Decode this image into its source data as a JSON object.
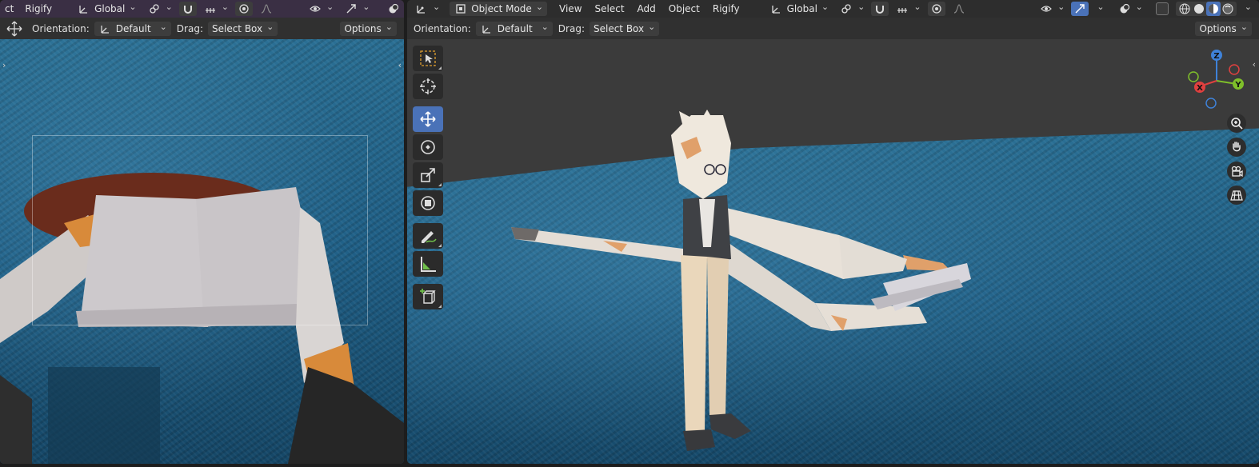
{
  "left_editor": {
    "header": {
      "truncated_menu": "ct",
      "menu_rigify": "Rigify",
      "transform_orientation": "Global"
    },
    "tool_settings": {
      "orientation_label": "Orientation:",
      "orientation_value": "Default",
      "drag_label": "Drag:",
      "drag_value": "Select Box",
      "options_label": "Options"
    }
  },
  "right_editor": {
    "header": {
      "mode": "Object Mode",
      "menus": [
        "View",
        "Select",
        "Add",
        "Object",
        "Rigify"
      ],
      "transform_orientation": "Global"
    },
    "tool_settings": {
      "orientation_label": "Orientation:",
      "orientation_value": "Default",
      "drag_label": "Drag:",
      "drag_value": "Select Box",
      "options_label": "Options"
    },
    "toolbar": [
      "select-box-tool",
      "cursor-tool",
      "move-tool",
      "rotate-tool",
      "scale-tool",
      "transform-tool",
      "annotate-tool",
      "measure-tool",
      "add-cube-tool"
    ],
    "gizmo": {
      "x": "X",
      "y": "Y",
      "z": "Z"
    }
  },
  "colors": {
    "accent": "#4a72b8",
    "axis_x": "#e0403f",
    "axis_y": "#7fbf2a",
    "axis_z": "#3f82d8"
  }
}
